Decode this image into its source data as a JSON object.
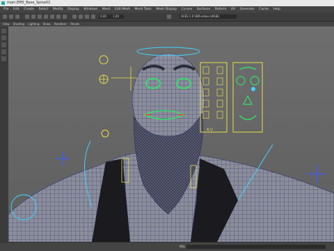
{
  "window": {
    "title": "main.EMS_Base_Spine02"
  },
  "menu": [
    "File",
    "Edit",
    "Create",
    "Select",
    "Modify",
    "Display",
    "Windows",
    "Mesh",
    "Edit Mesh",
    "Mesh Tools",
    "Mesh Display",
    "Curves",
    "Surfaces",
    "Deform",
    "UV",
    "Generate",
    "Cache",
    "Help"
  ],
  "toolbar": {
    "field1": "0.00",
    "field2": "1.00",
    "status": "ACES 1.0 SDR-video (sRGB)"
  },
  "panel": {
    "menus": [
      "View",
      "Shading",
      "Lighting",
      "Show",
      "Renderer",
      "Panels"
    ]
  },
  "rig": {
    "mouth_panel_label": "A U"
  },
  "statusbar": {
    "mel": "MEL"
  },
  "colors": {
    "wire": "#2b2f6e",
    "control": "#e8e04a",
    "ring": "#3fd6ff",
    "eye": "#34e06a"
  }
}
